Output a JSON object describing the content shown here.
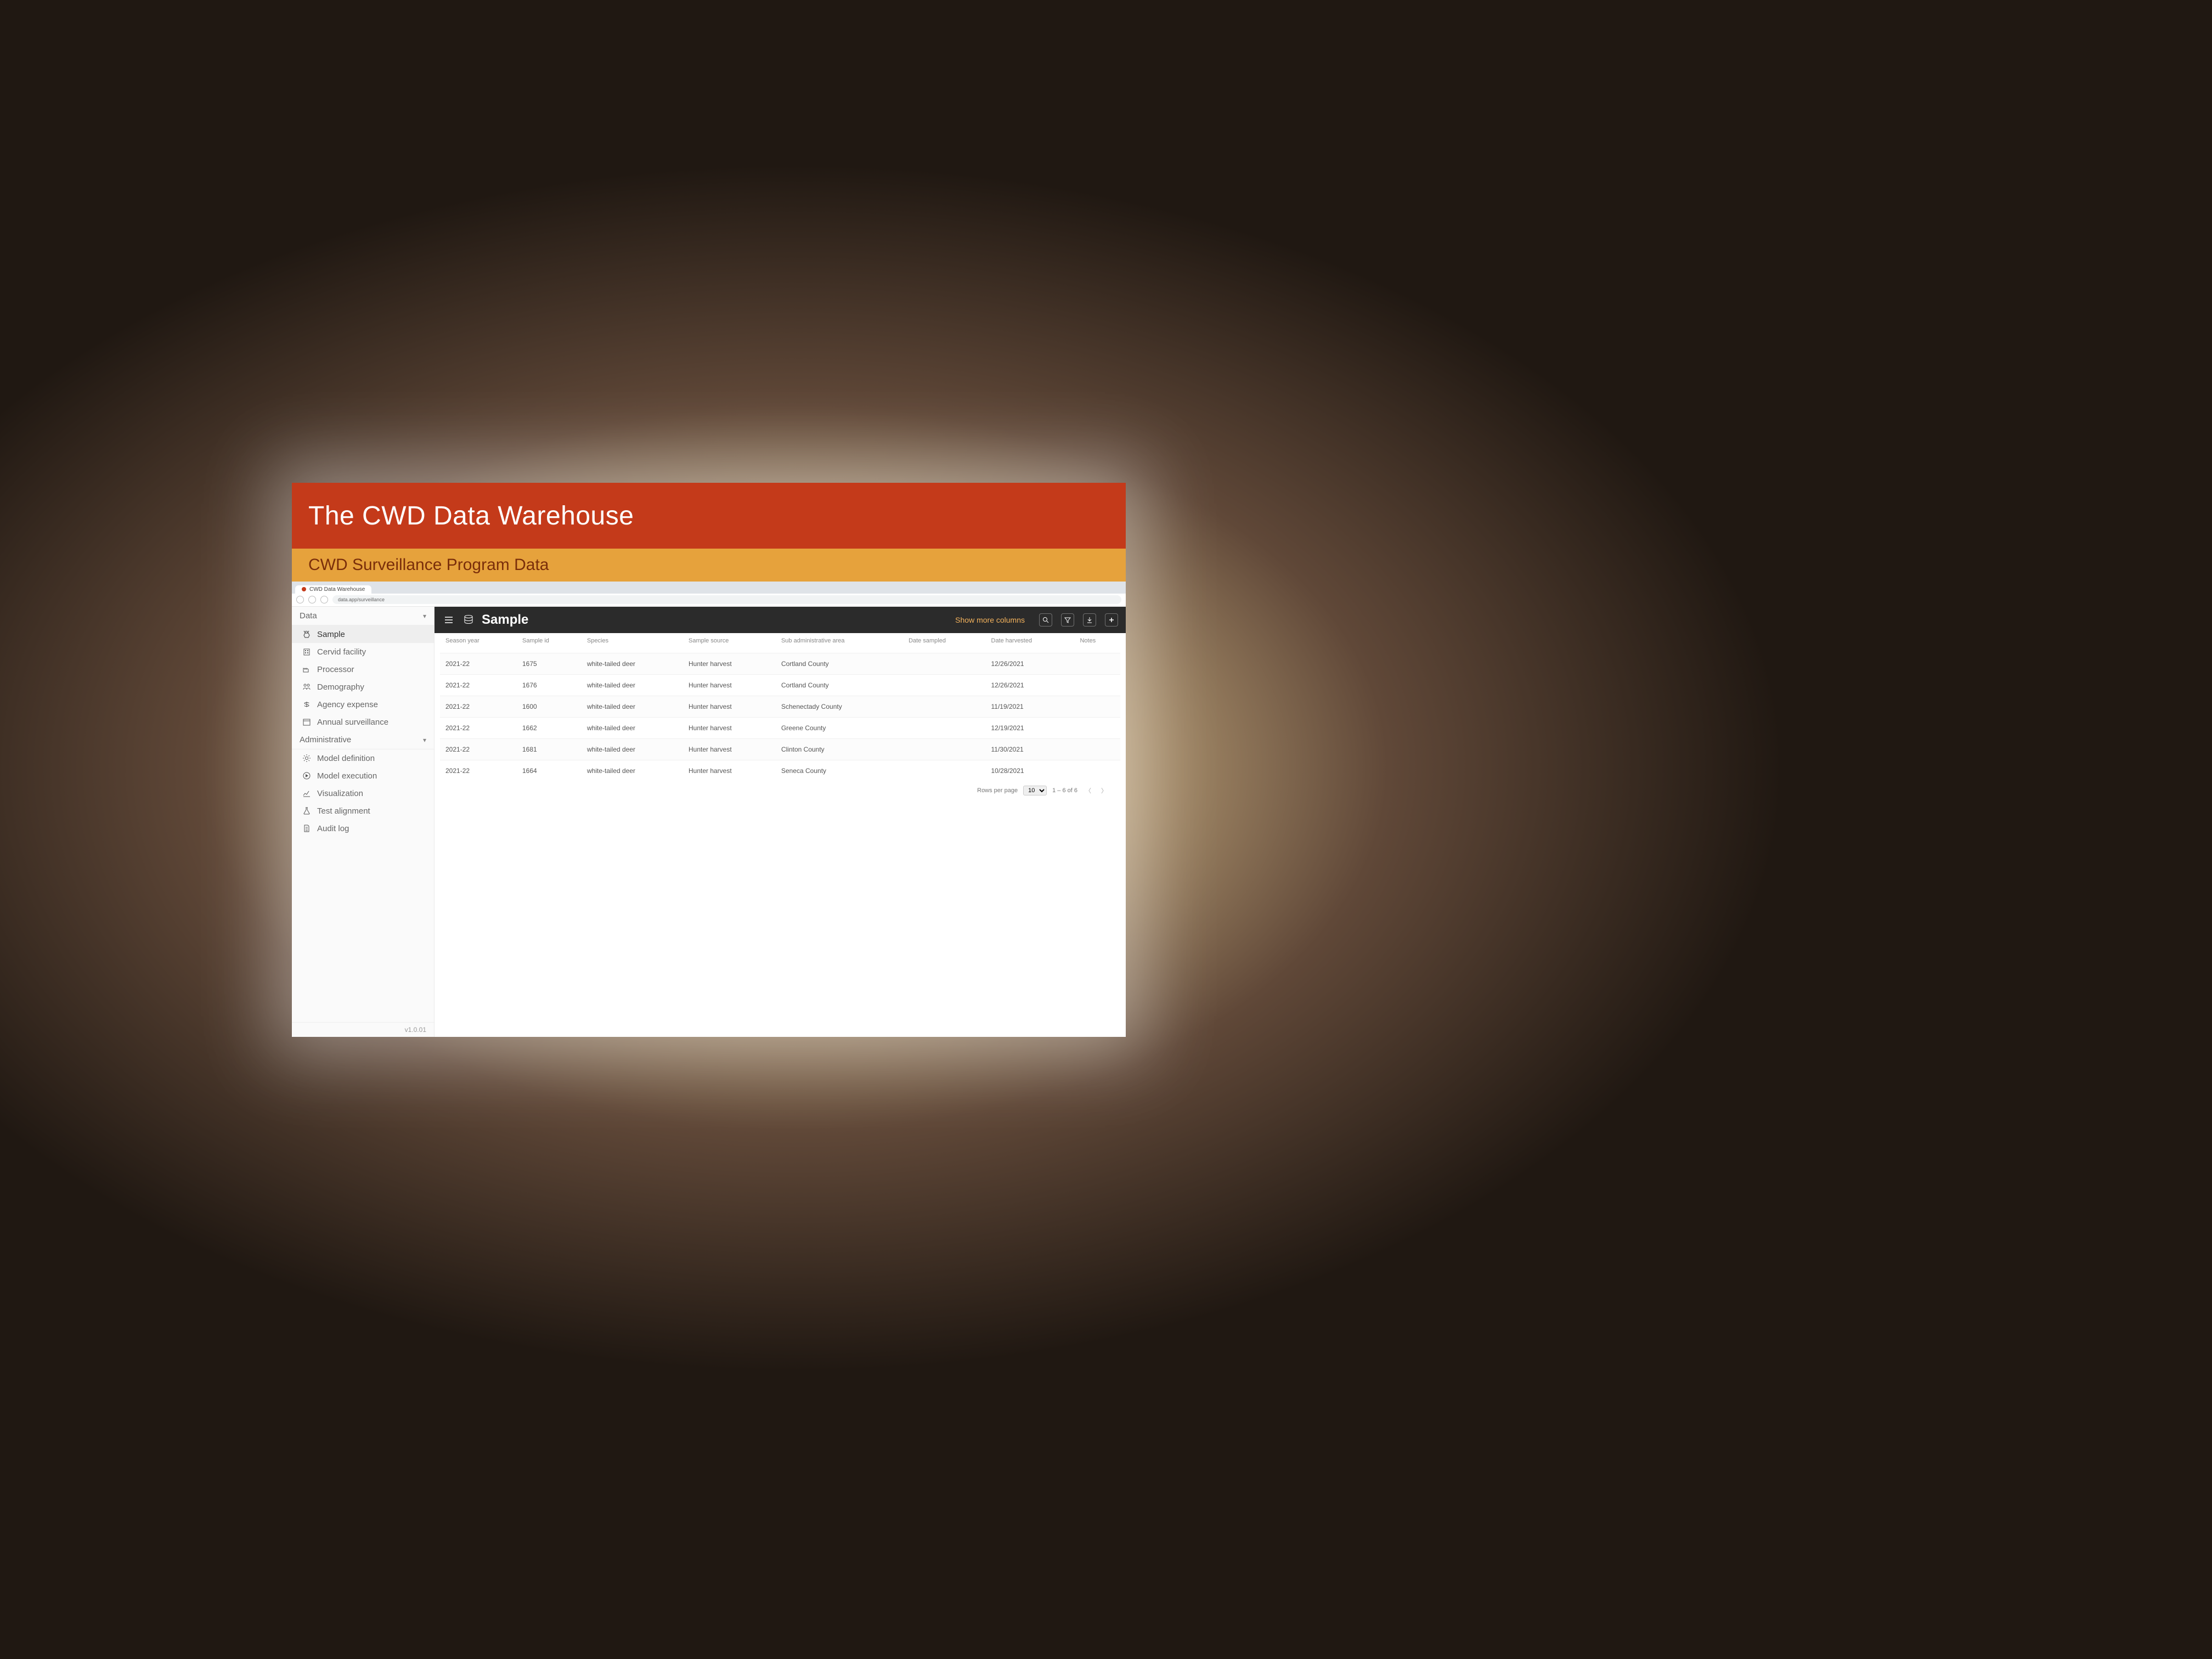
{
  "slide": {
    "title": "The CWD Data Warehouse",
    "subtitle": "CWD Surveillance Program Data"
  },
  "browser": {
    "tab_title": "CWD Data Warehouse",
    "address": "data.app/surveillance"
  },
  "sidebar": {
    "section_data": "Data",
    "section_admin": "Administrative",
    "items_data": [
      {
        "icon": "deer",
        "label": "Sample"
      },
      {
        "icon": "building",
        "label": "Cervid facility"
      },
      {
        "icon": "factory",
        "label": "Processor"
      },
      {
        "icon": "people",
        "label": "Demography"
      },
      {
        "icon": "money",
        "label": "Agency expense"
      },
      {
        "icon": "calendar",
        "label": "Annual surveillance"
      }
    ],
    "items_admin": [
      {
        "icon": "gear",
        "label": "Model definition"
      },
      {
        "icon": "play",
        "label": "Model execution"
      },
      {
        "icon": "chart",
        "label": "Visualization"
      },
      {
        "icon": "flask",
        "label": "Test alignment"
      },
      {
        "icon": "doc",
        "label": "Audit log"
      }
    ],
    "version": "v1.0.01"
  },
  "header": {
    "page_title": "Sample",
    "more_columns": "Show more columns",
    "toolbar_icons": [
      "search",
      "filter",
      "download",
      "add"
    ]
  },
  "table": {
    "columns": [
      "Season year",
      "Sample id",
      "Species",
      "Sample source",
      "Sub administrative area",
      "Date sampled",
      "Date harvested",
      "Notes"
    ],
    "rows": [
      {
        "season": "2021-22",
        "sample_id": "1675",
        "species": "white-tailed deer",
        "source": "Hunter harvest",
        "area": "Cortland County",
        "date_sampled": "",
        "date_harvested": "12/26/2021",
        "notes": ""
      },
      {
        "season": "2021-22",
        "sample_id": "1676",
        "species": "white-tailed deer",
        "source": "Hunter harvest",
        "area": "Cortland County",
        "date_sampled": "",
        "date_harvested": "12/26/2021",
        "notes": ""
      },
      {
        "season": "2021-22",
        "sample_id": "1600",
        "species": "white-tailed deer",
        "source": "Hunter harvest",
        "area": "Schenectady County",
        "date_sampled": "",
        "date_harvested": "11/19/2021",
        "notes": ""
      },
      {
        "season": "2021-22",
        "sample_id": "1662",
        "species": "white-tailed deer",
        "source": "Hunter harvest",
        "area": "Greene County",
        "date_sampled": "",
        "date_harvested": "12/19/2021",
        "notes": ""
      },
      {
        "season": "2021-22",
        "sample_id": "1681",
        "species": "white-tailed deer",
        "source": "Hunter harvest",
        "area": "Clinton County",
        "date_sampled": "",
        "date_harvested": "11/30/2021",
        "notes": ""
      },
      {
        "season": "2021-22",
        "sample_id": "1664",
        "species": "white-tailed deer",
        "source": "Hunter harvest",
        "area": "Seneca County",
        "date_sampled": "",
        "date_harvested": "10/28/2021",
        "notes": ""
      }
    ]
  },
  "pager": {
    "rows_per_page_label": "Rows per page",
    "rows_per_page_value": "10",
    "range": "1 – 6 of 6"
  }
}
